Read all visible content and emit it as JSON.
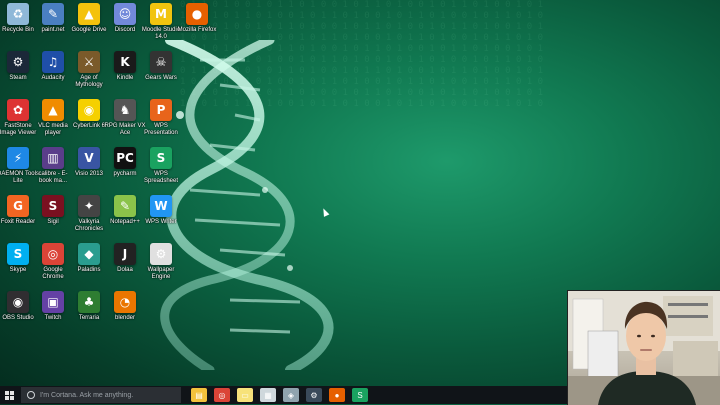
{
  "desktop": {
    "icons": [
      {
        "label": "Recycle Bin",
        "icon": "recycle-bin-icon",
        "color": "#8fb8d8",
        "glyph": "♻"
      },
      {
        "label": "paint.net",
        "icon": "paint-net-icon",
        "color": "#4a7fc1",
        "glyph": "✎"
      },
      {
        "label": "Google Drive",
        "icon": "google-drive-icon",
        "color": "#f4c20d",
        "glyph": "▲"
      },
      {
        "label": "Discord",
        "icon": "discord-icon",
        "color": "#7289da",
        "glyph": "☺"
      },
      {
        "label": "Moodle Studio 14.0",
        "icon": "moodle-studio-icon",
        "color": "#f1c40f",
        "glyph": "M"
      },
      {
        "label": "Mozilla Firefox",
        "icon": "firefox-icon",
        "color": "#e66000",
        "glyph": "●"
      },
      {
        "label": "Steam",
        "icon": "steam-icon",
        "color": "#1b2838",
        "glyph": "⚙"
      },
      {
        "label": "Audacity",
        "icon": "audacity-icon",
        "color": "#1f4fa8",
        "glyph": "♫"
      },
      {
        "label": "Age of Mythology",
        "icon": "age-of-mythology-icon",
        "color": "#7a5a2a",
        "glyph": "⚔"
      },
      {
        "label": "Kindle",
        "icon": "kindle-icon",
        "color": "#1a1a1a",
        "glyph": "K"
      },
      {
        "label": "Gears Wars",
        "icon": "gears-icon",
        "color": "#333333",
        "glyph": "☠"
      },
      {
        "label": "FastStone Image Viewer",
        "icon": "faststone-icon",
        "color": "#d33",
        "glyph": "✿"
      },
      {
        "label": "VLC media player",
        "icon": "vlc-icon",
        "color": "#f08c00",
        "glyph": "▲"
      },
      {
        "label": "CyberLink 6",
        "icon": "cyberlink-icon",
        "color": "#f5d000",
        "glyph": "◉"
      },
      {
        "label": "RPG Maker VX Ace",
        "icon": "rpg-maker-icon",
        "color": "#555555",
        "glyph": "♞"
      },
      {
        "label": "WPS Presentation",
        "icon": "wps-presentation-icon",
        "color": "#e8641b",
        "glyph": "P"
      },
      {
        "label": "DAEMON Tools Lite",
        "icon": "daemon-tools-icon",
        "color": "#1e88e5",
        "glyph": "⚡"
      },
      {
        "label": "calibre - E-book ma...",
        "icon": "calibre-icon",
        "color": "#5a3d8a",
        "glyph": "▥"
      },
      {
        "label": "Visio 2013",
        "icon": "visio-icon",
        "color": "#3955a3",
        "glyph": "V"
      },
      {
        "label": "pycharm",
        "icon": "pycharm-icon",
        "color": "#111111",
        "glyph": "PC"
      },
      {
        "label": "WPS Spreadsheet",
        "icon": "wps-spreadsheet-icon",
        "color": "#1aa260",
        "glyph": "S"
      },
      {
        "label": "Foxit Reader",
        "icon": "foxit-icon",
        "color": "#f26522",
        "glyph": "G"
      },
      {
        "label": "Sigil",
        "icon": "sigil-icon",
        "color": "#7a1020",
        "glyph": "S"
      },
      {
        "label": "Valkyria Chronicles",
        "icon": "valkyria-icon",
        "color": "#444444",
        "glyph": "✦"
      },
      {
        "label": "Notepad++",
        "icon": "notepad-plus-icon",
        "color": "#8bc34a",
        "glyph": "✎"
      },
      {
        "label": "WPS Writer",
        "icon": "wps-writer-icon",
        "color": "#2196f3",
        "glyph": "W"
      },
      {
        "label": "Skype",
        "icon": "skype-icon",
        "color": "#00aff0",
        "glyph": "S"
      },
      {
        "label": "Google Chrome",
        "icon": "chrome-icon",
        "color": "#db4437",
        "glyph": "◎"
      },
      {
        "label": "Paladins",
        "icon": "paladins-icon",
        "color": "#2a9d8f",
        "glyph": "◆"
      },
      {
        "label": "Dolaa",
        "icon": "dolaa-icon",
        "color": "#222222",
        "glyph": "J"
      },
      {
        "label": "Wallpaper Engine",
        "icon": "wallpaper-engine-icon",
        "color": "#e0e0e0",
        "glyph": "⚙"
      },
      {
        "label": "OBS Studio",
        "icon": "obs-icon",
        "color": "#302e31",
        "glyph": "◉"
      },
      {
        "label": "Twitch",
        "icon": "twitch-icon",
        "color": "#6441a5",
        "glyph": "▣"
      },
      {
        "label": "Terraria",
        "icon": "terraria-icon",
        "color": "#2e7d32",
        "glyph": "♣"
      },
      {
        "label": "blender",
        "icon": "blender-icon",
        "color": "#ea7600",
        "glyph": "◔"
      }
    ]
  },
  "taskbar": {
    "search_placeholder": "I'm Cortana. Ask me anything.",
    "pinned": [
      {
        "icon": "file-explorer-icon",
        "color": "#f3c23c",
        "glyph": "▤"
      },
      {
        "icon": "chrome-taskbar-icon",
        "color": "#db4437",
        "glyph": "◎"
      },
      {
        "icon": "sticky-notes-icon",
        "color": "#f7e27a",
        "glyph": "▭"
      },
      {
        "icon": "document-app-icon",
        "color": "#cfd8dc",
        "glyph": "▦"
      },
      {
        "icon": "window-app-icon",
        "color": "#90a4ae",
        "glyph": "◈"
      },
      {
        "icon": "steam-taskbar-icon",
        "color": "#3a4a5a",
        "glyph": "⚙"
      },
      {
        "icon": "firefox-taskbar-icon",
        "color": "#e66000",
        "glyph": "●"
      },
      {
        "icon": "wps-spreadsheet-taskbar-icon",
        "color": "#1aa260",
        "glyph": "S"
      }
    ]
  }
}
